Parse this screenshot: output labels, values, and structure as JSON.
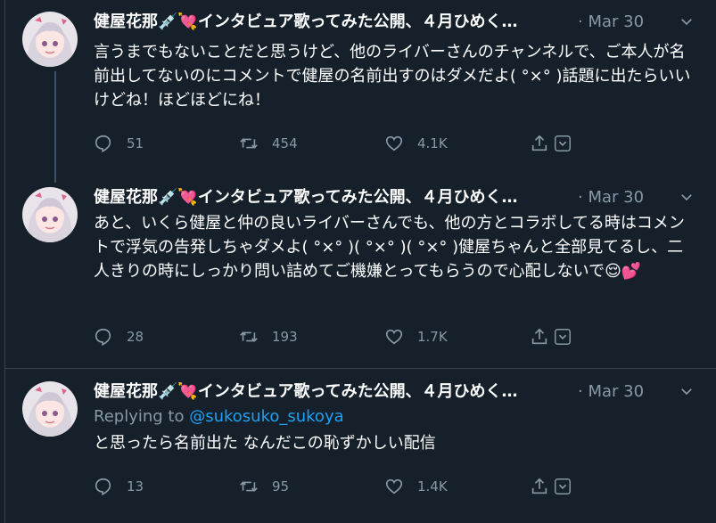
{
  "tweets": [
    {
      "name": "健屋花那💉💘インタビュア歌ってみた公開、４月ひめく…",
      "meta": "· Mar 30",
      "text": "言うまでもないことだと思うけど、他のライバーさんのチャンネルで、ご本人が名前出してないのにコメントで健屋の名前出すのはダメだよ( °×° )話題に出たらいいけどね！ほどほどにね！",
      "replies": "51",
      "retweets": "454",
      "likes": "4.1K"
    },
    {
      "name": "健屋花那💉💘インタビュア歌ってみた公開、４月ひめく…",
      "meta": "· Mar 30",
      "text": "あと、いくら健屋と仲の良いライバーさんでも、他の方とコラボしてる時はコメントで浮気の告発しちゃダメよ( °×° )( °×° )( °×° )健屋ちゃんと全部見てるし、二人きりの時にしっかり問い詰めてご機嫌とってもらうので心配しないで😌💕",
      "replies": "28",
      "retweets": "193",
      "likes": "1.7K"
    },
    {
      "name": "健屋花那💉💘インタビュア歌ってみた公開、４月ひめく…",
      "meta": "· Mar 30",
      "replying_prefix": "Replying to ",
      "replying_handle": "@sukosuko_sukoya",
      "text": "と思ったら名前出た なんだこの恥ずかしい配信",
      "replies": "13",
      "retweets": "95",
      "likes": "1.4K"
    }
  ],
  "icons": [
    "reply-icon",
    "retweet-icon",
    "like-icon",
    "share-icon",
    "chevron-down-icon"
  ]
}
